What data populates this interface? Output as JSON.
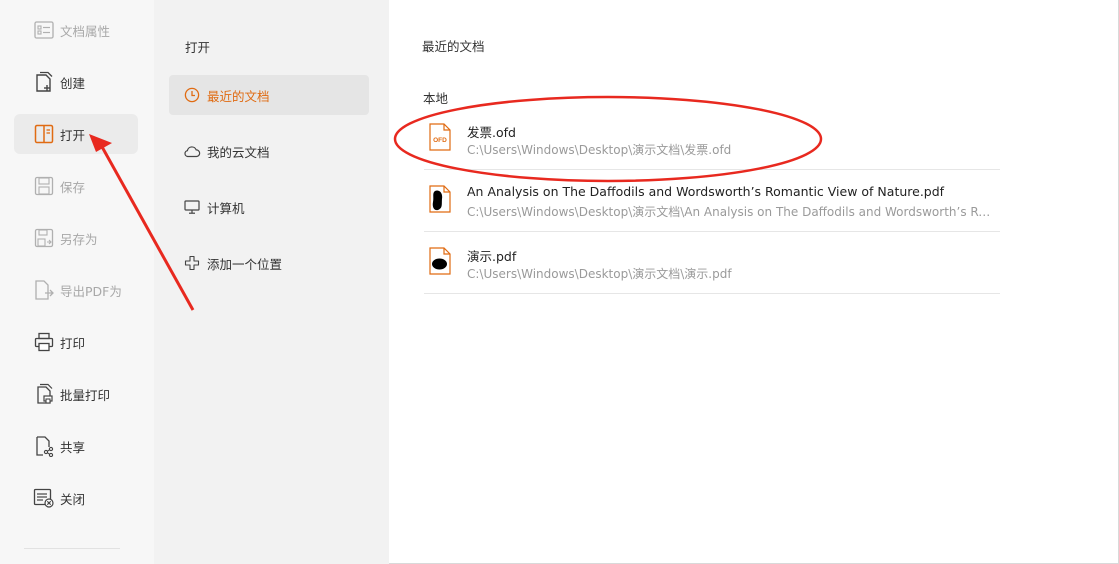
{
  "menu": {
    "items": [
      {
        "label": "文档属性",
        "icon": "doc-properties-icon",
        "disabled": true
      },
      {
        "label": "创建",
        "icon": "create-doc-icon",
        "disabled": false
      },
      {
        "label": "打开",
        "icon": "open-doc-icon",
        "disabled": false,
        "active": true
      },
      {
        "label": "保存",
        "icon": "save-icon",
        "disabled": true
      },
      {
        "label": "另存为",
        "icon": "save-as-icon",
        "disabled": true
      },
      {
        "label": "导出PDF为",
        "icon": "export-pdf-icon",
        "disabled": true
      },
      {
        "label": "打印",
        "icon": "print-icon",
        "disabled": false
      },
      {
        "label": "批量打印",
        "icon": "batch-print-icon",
        "disabled": false
      },
      {
        "label": "共享",
        "icon": "share-icon",
        "disabled": false
      },
      {
        "label": "关闭",
        "icon": "close-doc-icon",
        "disabled": false
      }
    ]
  },
  "open_panel": {
    "title": "打开",
    "locations": [
      {
        "label": "最近的文档",
        "icon": "clock-icon",
        "active": true
      },
      {
        "label": "我的云文档",
        "icon": "cloud-icon"
      },
      {
        "label": "计算机",
        "icon": "monitor-icon"
      },
      {
        "label": "添加一个位置",
        "icon": "plus-icon"
      }
    ]
  },
  "recent": {
    "title": "最近的文档",
    "section": "本地",
    "files": [
      {
        "name": "发票.ofd",
        "path": "C:\\Users\\Windows\\Desktop\\演示文档\\发票.ofd",
        "icon": "ofd-file-icon",
        "icon_text": "OFD"
      },
      {
        "name": "An Analysis on The Daffodils and Wordsworth’s Romantic View of Nature.pdf",
        "path": "C:\\Users\\Windows\\Desktop\\演示文档\\An Analysis on The Daffodils and Wordsworth’s Romantic View of Nature.pdf",
        "icon": "pdf-file-icon"
      },
      {
        "name": "演示.pdf",
        "path": "C:\\Users\\Windows\\Desktop\\演示文档\\演示.pdf",
        "icon": "pdf-file-icon"
      }
    ]
  },
  "colors": {
    "accent": "#e06b12",
    "annotation_red": "#e8291f"
  }
}
